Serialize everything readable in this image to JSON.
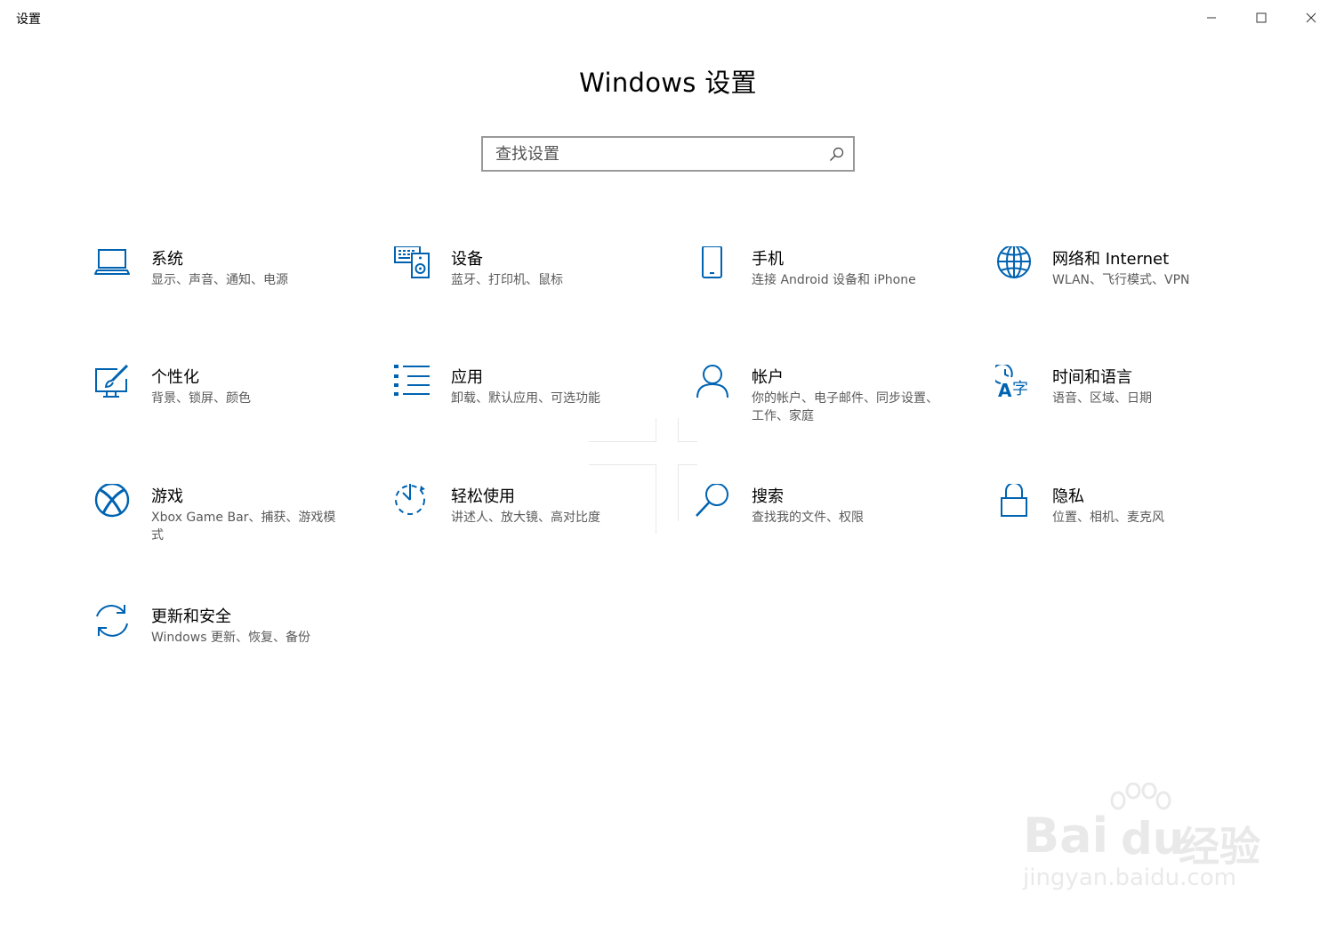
{
  "window": {
    "title": "设置",
    "controls": [
      "minimize",
      "maximize",
      "close"
    ]
  },
  "header": {
    "title": "Windows 设置"
  },
  "search": {
    "placeholder": "查找设置",
    "value": ""
  },
  "accent_color": "#0063b1",
  "tiles": [
    {
      "id": "system",
      "icon": "laptop-icon",
      "title": "系统",
      "desc": "显示、声音、通知、电源"
    },
    {
      "id": "devices",
      "icon": "devices-icon",
      "title": "设备",
      "desc": "蓝牙、打印机、鼠标"
    },
    {
      "id": "phone",
      "icon": "phone-icon",
      "title": "手机",
      "desc": "连接 Android 设备和 iPhone"
    },
    {
      "id": "network",
      "icon": "globe-icon",
      "title": "网络和 Internet",
      "desc": "WLAN、飞行模式、VPN"
    },
    {
      "id": "personalization",
      "icon": "paint-icon",
      "title": "个性化",
      "desc": "背景、锁屏、颜色"
    },
    {
      "id": "apps",
      "icon": "apps-list-icon",
      "title": "应用",
      "desc": "卸载、默认应用、可选功能"
    },
    {
      "id": "accounts",
      "icon": "person-icon",
      "title": "帐户",
      "desc": "你的帐户、电子邮件、同步设置、工作、家庭"
    },
    {
      "id": "time-language",
      "icon": "time-language-icon",
      "title": "时间和语言",
      "desc": "语音、区域、日期"
    },
    {
      "id": "gaming",
      "icon": "xbox-icon",
      "title": "游戏",
      "desc": "Xbox Game Bar、捕获、游戏模式"
    },
    {
      "id": "ease-of-access",
      "icon": "ease-of-access-icon",
      "title": "轻松使用",
      "desc": "讲述人、放大镜、高对比度"
    },
    {
      "id": "search",
      "icon": "magnifier-icon",
      "title": "搜索",
      "desc": "查找我的文件、权限"
    },
    {
      "id": "privacy",
      "icon": "lock-icon",
      "title": "隐私",
      "desc": "位置、相机、麦克风"
    },
    {
      "id": "update-security",
      "icon": "sync-icon",
      "title": "更新和安全",
      "desc": "Windows 更新、恢复、备份"
    }
  ],
  "watermark": {
    "brand": "Bai",
    "brand2": "du",
    "cn": "经验",
    "url": "jingyan.baidu.com"
  }
}
